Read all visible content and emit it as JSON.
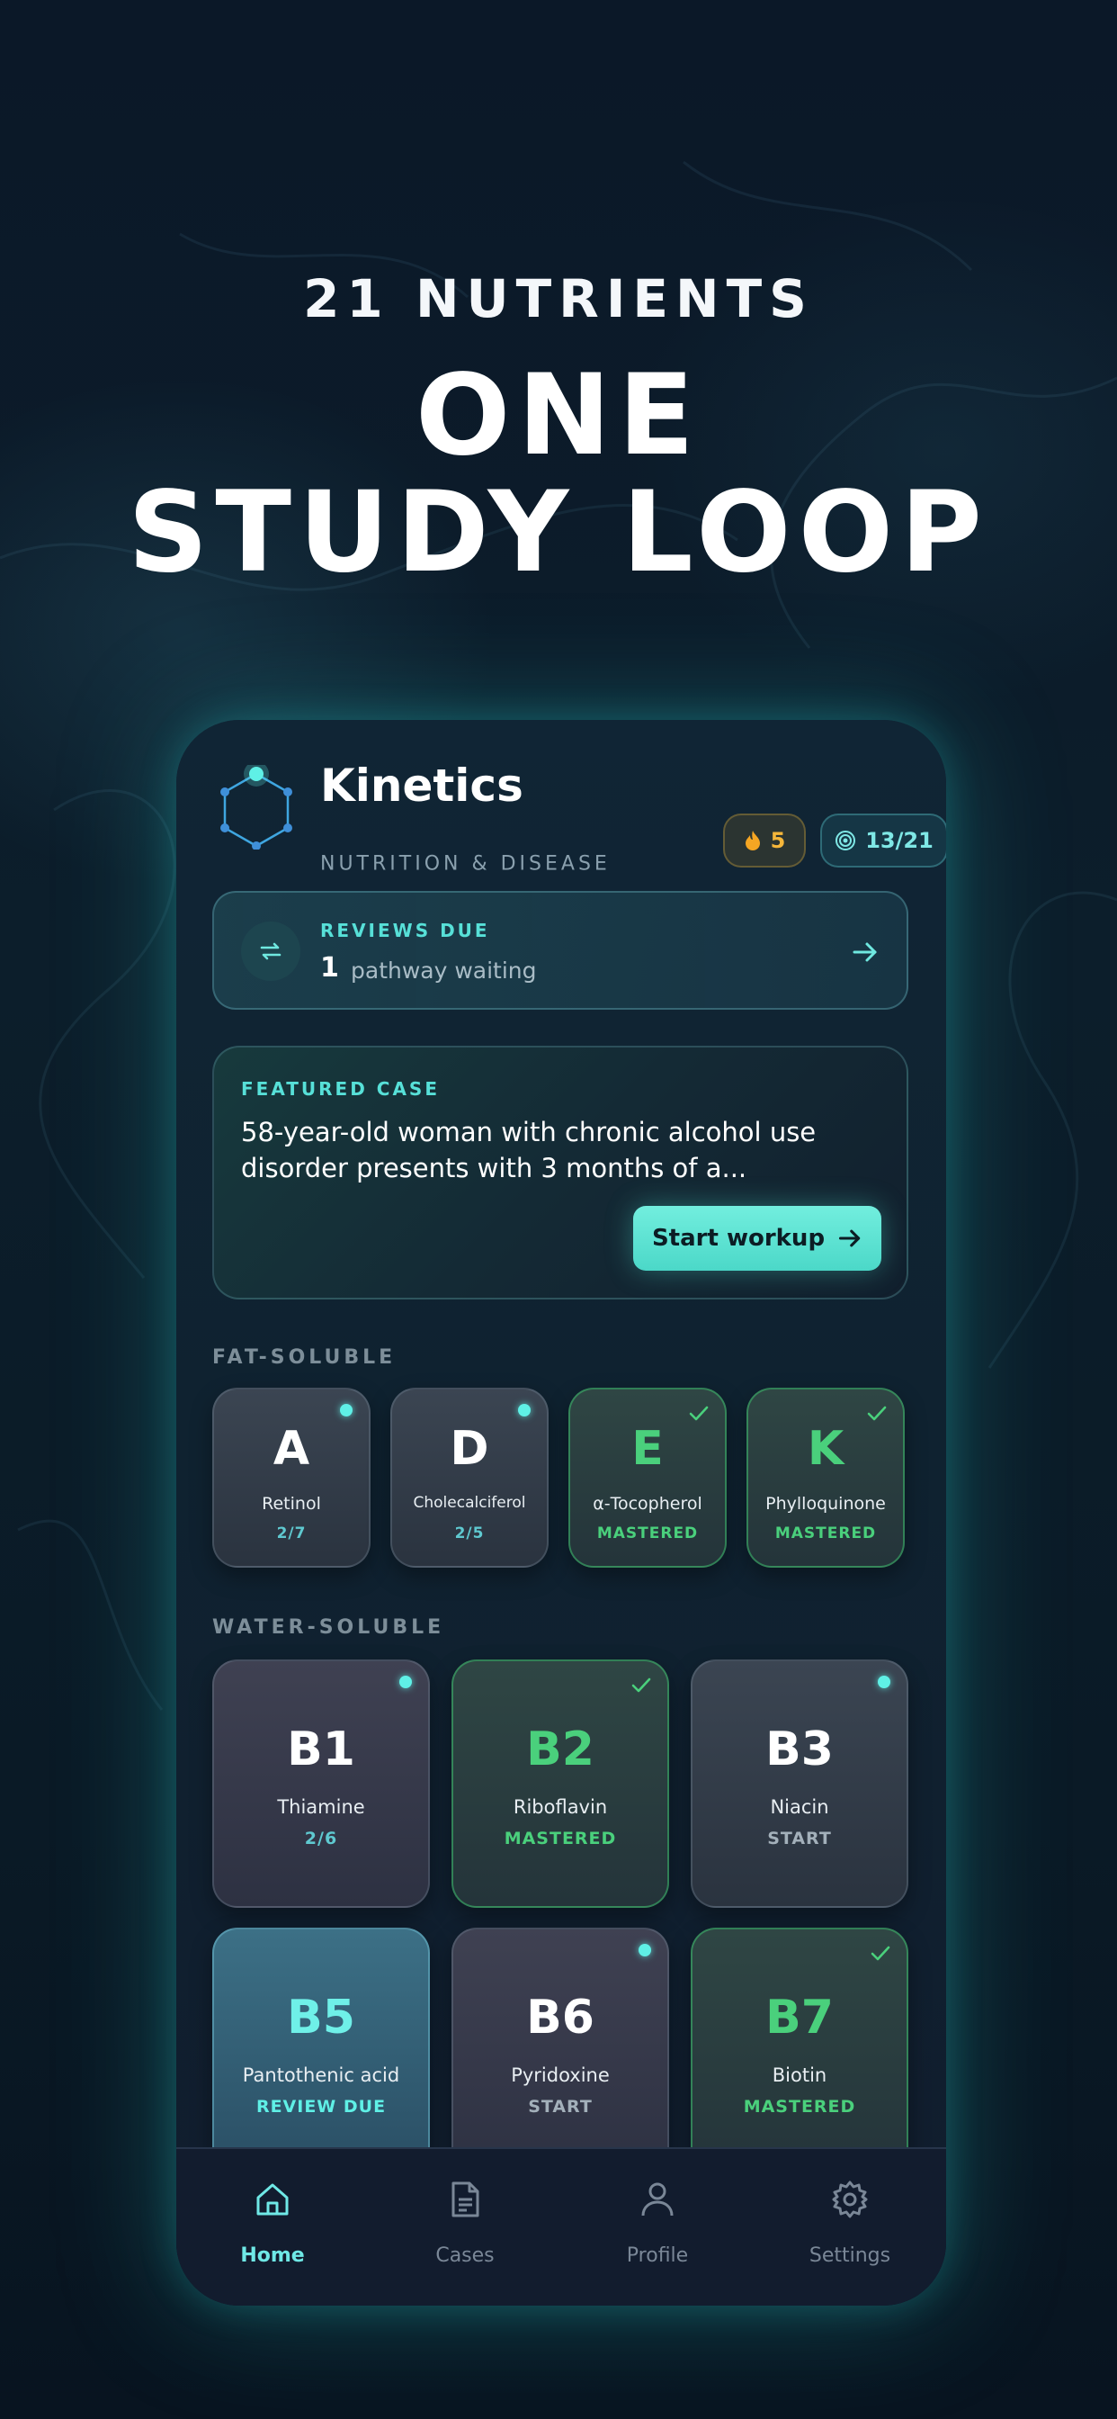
{
  "hero": {
    "kicker": "21 NUTRIENTS",
    "line1": "ONE",
    "line2": "STUDY LOOP"
  },
  "app": {
    "title": "Kinetics",
    "subtitle": "NUTRITION & DISEASE",
    "streak_icon": "flame-icon",
    "streak": "5",
    "progress_icon": "target-icon",
    "progress": "13/21"
  },
  "reviews": {
    "label": "REVIEWS DUE",
    "count": "1",
    "text": "pathway waiting"
  },
  "featured": {
    "label": "FEATURED CASE",
    "text": "58-year-old woman with chronic alcohol use disorder presents with 3 months of a...",
    "button": "Start workup"
  },
  "fat_soluble": {
    "title": "FAT-SOLUBLE",
    "cards": [
      {
        "letter": "A",
        "name": "Retinol",
        "status": "2/7"
      },
      {
        "letter": "D",
        "name": "Cholecalciferol",
        "status": "2/5"
      },
      {
        "letter": "E",
        "name": "α-Tocopherol",
        "status": "MASTERED"
      },
      {
        "letter": "K",
        "name": "Phylloquinone",
        "status": "MASTERED"
      }
    ]
  },
  "water_soluble": {
    "title": "WATER-SOLUBLE",
    "cards": [
      {
        "letter": "B1",
        "name": "Thiamine",
        "status": "2/6"
      },
      {
        "letter": "B2",
        "name": "Riboflavin",
        "status": "MASTERED"
      },
      {
        "letter": "B3",
        "name": "Niacin",
        "status": "START"
      },
      {
        "letter": "B5",
        "name": "Pantothenic acid",
        "status": "REVIEW DUE"
      },
      {
        "letter": "B6",
        "name": "Pyridoxine",
        "status": "START"
      },
      {
        "letter": "B7",
        "name": "Biotin",
        "status": "MASTERED"
      }
    ]
  },
  "tabs": [
    {
      "label": "Home",
      "icon": "home-icon"
    },
    {
      "label": "Cases",
      "icon": "document-icon"
    },
    {
      "label": "Profile",
      "icon": "person-icon"
    },
    {
      "label": "Settings",
      "icon": "gear-icon"
    }
  ],
  "colors": {
    "accent": "#5ff0e6",
    "mastered": "#4ad07c",
    "streak": "#f5b63a",
    "background": "#0a1624"
  }
}
